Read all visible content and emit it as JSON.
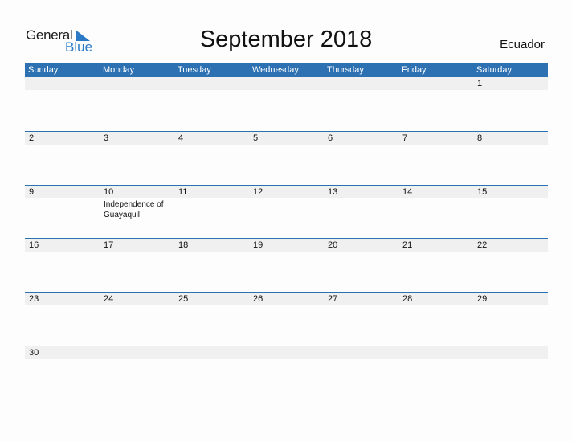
{
  "logo": {
    "general": "General",
    "blue": "Blue"
  },
  "title": "September 2018",
  "country": "Ecuador",
  "days": [
    "Sunday",
    "Monday",
    "Tuesday",
    "Wednesday",
    "Thursday",
    "Friday",
    "Saturday"
  ],
  "weeks": [
    [
      "",
      "",
      "",
      "",
      "",
      "",
      "1"
    ],
    [
      "2",
      "3",
      "4",
      "5",
      "6",
      "7",
      "8"
    ],
    [
      "9",
      "10",
      "11",
      "12",
      "13",
      "14",
      "15"
    ],
    [
      "16",
      "17",
      "18",
      "19",
      "20",
      "21",
      "22"
    ],
    [
      "23",
      "24",
      "25",
      "26",
      "27",
      "28",
      "29"
    ],
    [
      "30",
      "",
      "",
      "",
      "",
      "",
      ""
    ]
  ],
  "holidays": {
    "10": "Independence of Guayaquil"
  },
  "colors": {
    "accent": "#2e71b3",
    "band": "#f0f0f0",
    "logo_blue": "#2a7ac8"
  }
}
